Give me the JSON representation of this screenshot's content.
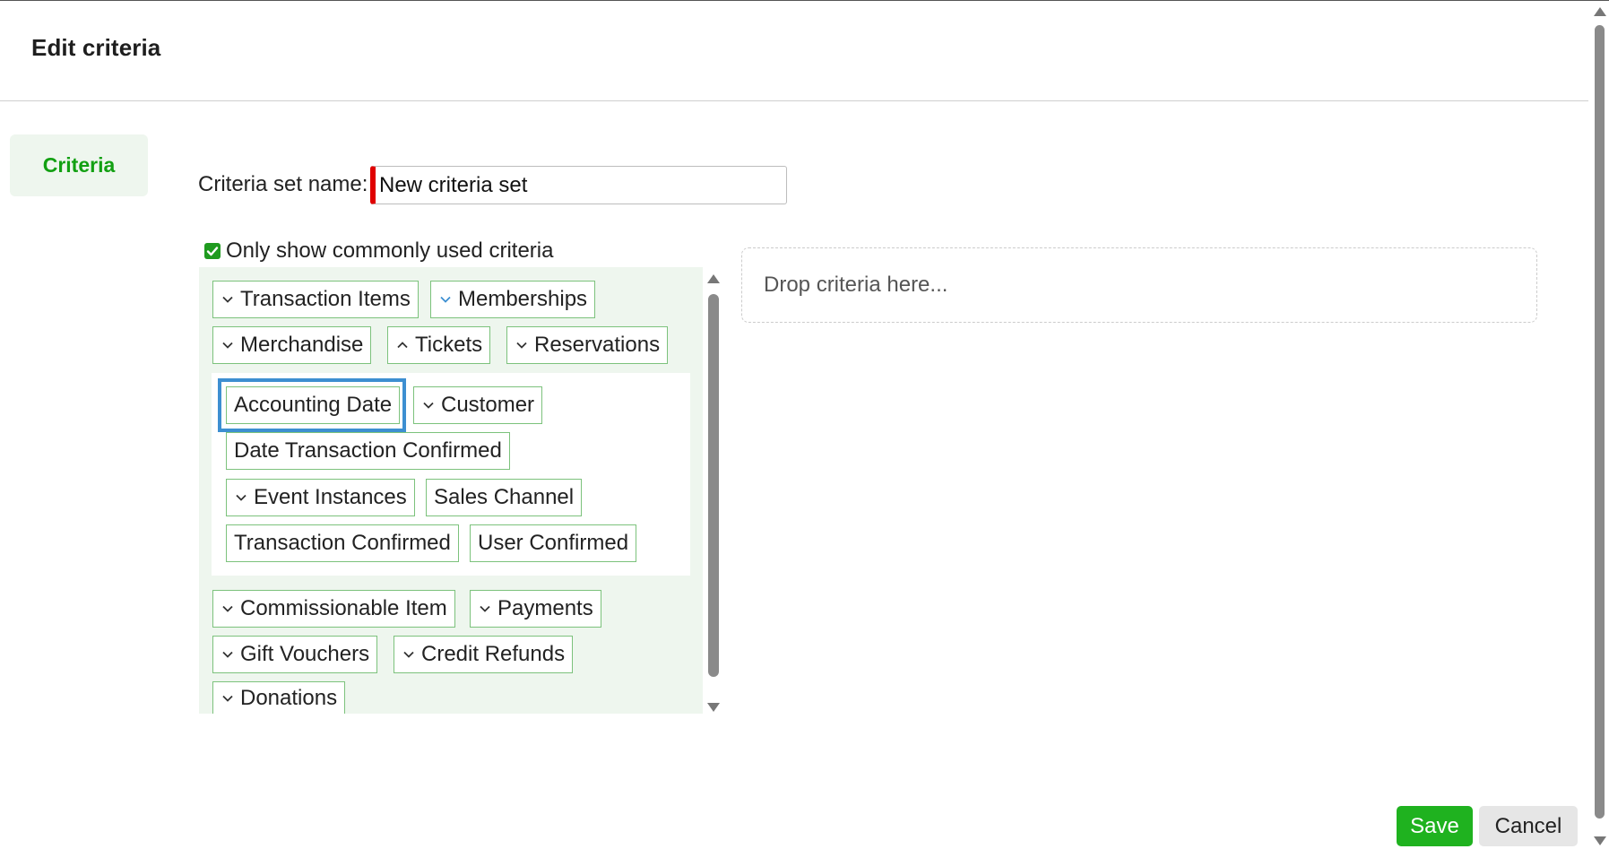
{
  "dialog": {
    "title": "Edit criteria"
  },
  "sidebar": {
    "tab_label": "Criteria"
  },
  "form": {
    "name_label": "Criteria set name:",
    "name_value": "New criteria set",
    "common_only_label": "Only show commonly used criteria",
    "common_only_checked": true
  },
  "tree": {
    "transaction_items": "Transaction Items",
    "memberships": "Memberships",
    "merchandise": "Merchandise",
    "tickets": "Tickets",
    "reservations": "Reservations",
    "ticket_children": {
      "accounting_date": "Accounting Date",
      "customer": "Customer",
      "date_transaction_confirmed": "Date Transaction Confirmed",
      "event_instances": "Event Instances",
      "sales_channel": "Sales Channel",
      "transaction_confirmed": "Transaction Confirmed",
      "user_confirmed": "User Confirmed"
    },
    "commissionable_item": "Commissionable Item",
    "payments": "Payments",
    "gift_vouchers": "Gift Vouchers",
    "credit_refunds": "Credit Refunds",
    "donations": "Donations"
  },
  "drop_zone": {
    "placeholder": "Drop criteria here..."
  },
  "actions": {
    "save": "Save",
    "cancel": "Cancel"
  },
  "colors": {
    "accent_green": "#1fb21f",
    "focus_blue": "#3d8fd1",
    "required_red": "#e00000",
    "panel_bg": "#eef6ee"
  }
}
